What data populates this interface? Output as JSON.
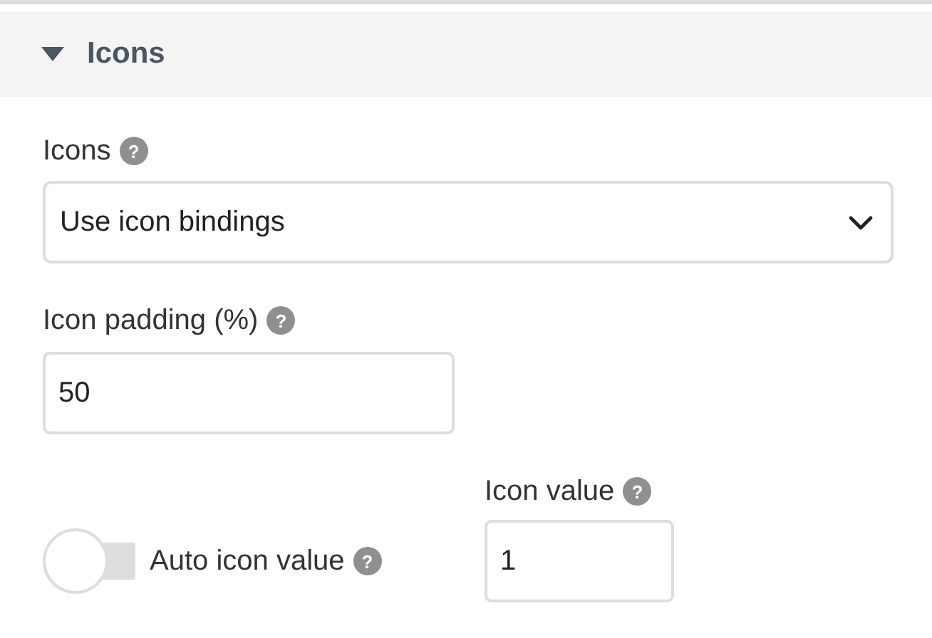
{
  "section": {
    "title": "Icons",
    "expanded": true
  },
  "icons_field": {
    "label": "Icons",
    "help": "?",
    "value": "Use icon bindings"
  },
  "padding_field": {
    "label": "Icon padding (%)",
    "help": "?",
    "value": "50"
  },
  "auto_toggle": {
    "label": "Auto icon value",
    "help": "?",
    "on": false
  },
  "value_field": {
    "label": "Icon value",
    "help": "?",
    "value": "1"
  }
}
